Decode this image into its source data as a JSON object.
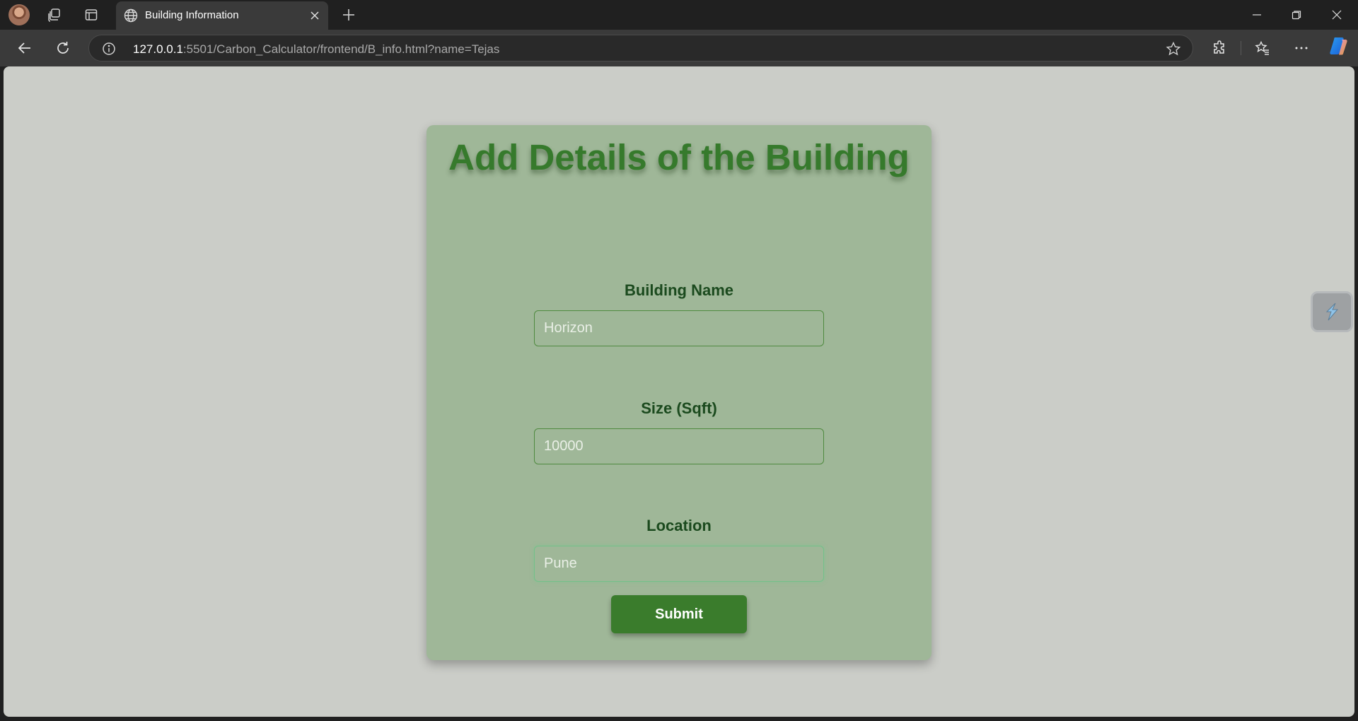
{
  "browser": {
    "tab_title": "Building Information",
    "url_host": "127.0.0.1",
    "url_rest": ":5501/Carbon_Calculator/frontend/B_info.html?name=Tejas"
  },
  "icons": {
    "profile": "avatar",
    "workspaces": "workspaces-icon",
    "tab_actions": "tab-actions-icon",
    "tab_favicon": "globe-icon",
    "close_tab": "close-icon",
    "new_tab": "plus-icon",
    "back": "back-arrow-icon",
    "reload": "reload-icon",
    "site_info": "info-icon",
    "favorite": "star-icon",
    "extensions": "puzzle-icon",
    "favorites": "favorites-list-icon",
    "more": "more-icon",
    "copilot": "copilot-icon"
  },
  "page": {
    "heading": "Add Details of the Building",
    "fields": [
      {
        "label": "Building Name",
        "placeholder": "Horizon"
      },
      {
        "label": "Size (Sqft)",
        "placeholder": "10000"
      },
      {
        "label": "Location",
        "placeholder": "Pune"
      }
    ],
    "submit_label": "Submit"
  },
  "colors": {
    "page_background": "#cbcdc8",
    "card_background": "#9fb798",
    "heading_color": "#367a2c",
    "label_color": "#1b4a1e",
    "button_color": "#3a7c2c"
  }
}
